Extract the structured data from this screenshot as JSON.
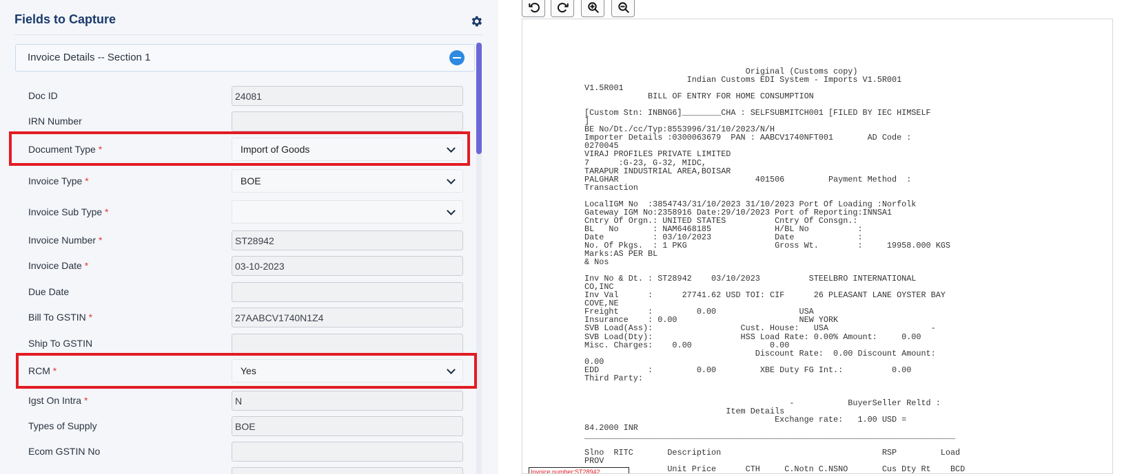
{
  "panel": {
    "title": "Fields to Capture"
  },
  "section": {
    "title": "Invoice Details -- Section 1"
  },
  "fields": [
    {
      "label": "Doc ID",
      "required": false,
      "type": "text",
      "value": "24081"
    },
    {
      "label": "IRN Number",
      "required": false,
      "type": "text",
      "value": ""
    },
    {
      "label": "Document Type",
      "required": true,
      "type": "select",
      "value": "Import of Goods"
    },
    {
      "label": "Invoice Type",
      "required": true,
      "type": "select",
      "value": "BOE"
    },
    {
      "label": "Invoice Sub Type",
      "required": true,
      "type": "select",
      "value": ""
    },
    {
      "label": "Invoice Number",
      "required": true,
      "type": "text",
      "value": "ST28942"
    },
    {
      "label": "Invoice Date",
      "required": true,
      "type": "text",
      "value": "03-10-2023"
    },
    {
      "label": "Due Date",
      "required": false,
      "type": "text",
      "value": ""
    },
    {
      "label": "Bill To GSTIN",
      "required": true,
      "type": "text",
      "value": "27AABCV1740N1Z4"
    },
    {
      "label": "Ship To GSTIN",
      "required": false,
      "type": "text",
      "value": ""
    },
    {
      "label": "RCM",
      "required": true,
      "type": "select",
      "value": "Yes"
    },
    {
      "label": "Igst On Intra",
      "required": true,
      "type": "text",
      "value": "N"
    },
    {
      "label": "Types of Supply",
      "required": false,
      "type": "text",
      "value": "BOE"
    },
    {
      "label": "Ecom GSTIN No",
      "required": false,
      "type": "text",
      "value": ""
    }
  ],
  "toolbar": {
    "buttons": [
      "rotate-left-icon",
      "rotate-right-icon",
      "zoom-in-icon",
      "zoom-out-icon"
    ]
  },
  "document": {
    "lines": [
      "                                 Original (Customs copy)",
      "                     Indian Customs EDI System - Imports V1.5R001",
      "V1.5R001",
      "             BILL OF ENTRY FOR HOME CONSUMPTION",
      "",
      "[Custom Stn: INBNG6]________CHA : SELFSUBMITCH001 [FILED BY IEC HIMSELF",
      "]",
      "BE No/Dt./cc/Typ:8553996/31/10/2023/N/H",
      "Importer Details :0300063679  PAN : AABCV1740NFT001       AD Code :",
      "0270045",
      "VIRAJ PROFILES PRIVATE LIMITED",
      "7      :G-23, G-32, MIDC,",
      "TARAPUR INDUSTRIAL AREA,BOISAR",
      "PALGHAR                            401506         Payment Method  :",
      "Transaction",
      "",
      "LocalIGM No  :3854743/31/10/2023 31/10/2023 Port Of Loading :Norfolk",
      "Gateway IGM No:2358916 Date:29/10/2023 Port of Reporting:INNSA1",
      "Cntry Of Orgn.: UNITED STATES          Cntry Of Consgn.:",
      "BL   No       : NAM6468185             H/BL No          :",
      "Date          : 03/10/2023             Date             :",
      "No. Of Pkgs.  : 1 PKG                  Gross Wt.        :     19958.000 KGS",
      "Marks:AS PER BL",
      "& Nos",
      "",
      "Inv No & Dt. : ST28942    03/10/2023          STEELBRO INTERNATIONAL",
      "CO,INC",
      "Inv Val      :      27741.62 USD TOI: CIF      26 PLEASANT LANE OYSTER BAY",
      "COVE,NE",
      "Freight      :         0.00                 USA",
      "Insurance    : 0.00                         NEW YORK",
      "SVB Load(Ass):                  Cust. House:   USA                     -",
      "SVB Load(Dty):                  HSS Load Rate: 0.00% Amount:     0.00",
      "Misc. Charges:    0.00                0.00",
      "                                   Discount Rate:  0.00 Discount Amount:",
      "0.00",
      "EDD          :         0.00         XBE Duty FG Int.:          0.00",
      "Third Party:",
      "",
      "",
      "                                          -           BuyerSeller Reltd :",
      "                             Item Details",
      "                                       Exchange rate:   1.00 USD =",
      "84.2000 INR",
      "____________________________________________________________________________",
      "",
      "Slno  RITC       Description                                 RSP         Load",
      "PROV",
      "                 Unit Price      CTH     C.Notn C.NSNO       Cus Dty Rt    BCD"
    ]
  },
  "overlay": {
    "text": "Invoice number:ST28942"
  }
}
